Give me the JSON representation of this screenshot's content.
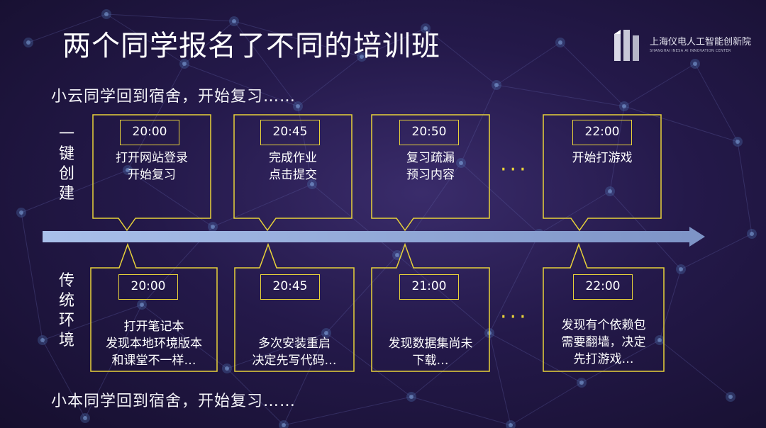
{
  "title": "两个同学报名了不同的培训班",
  "logo": {
    "name": "上海仪电人工智能创新院",
    "subtitle": "SHANGHAI INESA AI INNOVATION CENTER"
  },
  "top_intro": "小云同学回到宿舍，开始复习……",
  "bottom_intro": "小本同学回到宿舍，开始复习……",
  "top_label": [
    "一",
    "键",
    "创",
    "建"
  ],
  "bottom_label": [
    "传",
    "统",
    "环",
    "境"
  ],
  "ellipsis": "···",
  "top_events": [
    {
      "time": "20:00",
      "lines": [
        "打开网站登录",
        "开始复习"
      ]
    },
    {
      "time": "20:45",
      "lines": [
        "完成作业",
        "点击提交"
      ]
    },
    {
      "time": "20:50",
      "lines": [
        "复习疏漏",
        "预习内容"
      ]
    },
    {
      "time": "22:00",
      "lines": [
        "开始打游戏"
      ]
    }
  ],
  "bottom_events": [
    {
      "time": "20:00",
      "lines": [
        "打开笔记本",
        "发现本地环境版本",
        "和课堂不一样…"
      ]
    },
    {
      "time": "20:45",
      "lines": [
        "多次安装重启",
        "决定先写代码…"
      ]
    },
    {
      "time": "21:00",
      "lines": [
        "发现数据集尚未",
        "下载…"
      ]
    },
    {
      "time": "22:00",
      "lines": [
        "发现有个依赖包",
        "需要翻墙，决定",
        "先打游戏…"
      ]
    }
  ],
  "colors": {
    "accent": "#e8d23a",
    "arrow": "#8fa8d8",
    "background": "#24194a"
  }
}
